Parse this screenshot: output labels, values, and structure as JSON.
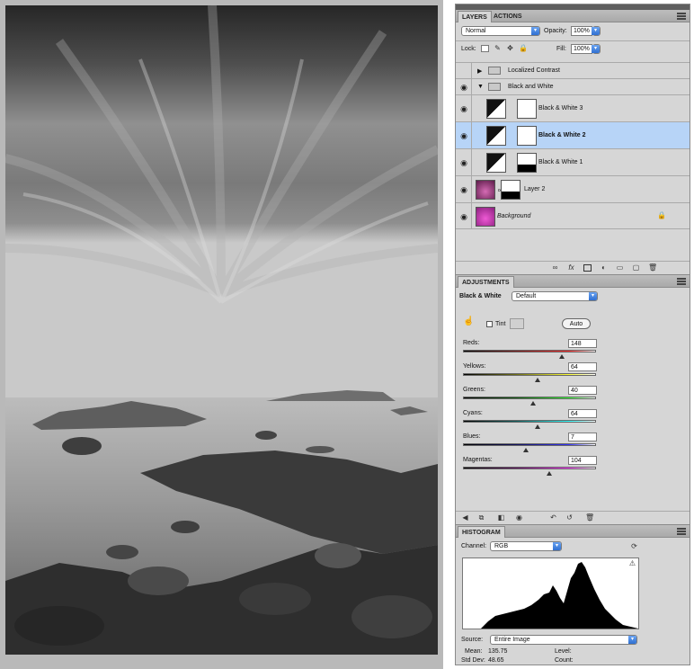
{
  "layers_panel": {
    "tabs": [
      "LAYERS",
      "ACTIONS"
    ],
    "blend_mode": "Normal",
    "opacity_label": "Opacity:",
    "opacity_value": "100%",
    "lock_label": "Lock:",
    "fill_label": "Fill:",
    "fill_value": "100%",
    "layers": [
      {
        "name": "Localized Contrast",
        "type": "group-collapsed",
        "visible": false
      },
      {
        "name": "Black and White",
        "type": "group-expanded",
        "visible": true
      },
      {
        "name": "Black & White 3",
        "type": "adjustment",
        "visible": true
      },
      {
        "name": "Black & White 2",
        "type": "adjustment",
        "visible": true,
        "selected": true
      },
      {
        "name": "Black & White 1",
        "type": "adjustment",
        "visible": true
      },
      {
        "name": "Layer 2",
        "type": "pixel",
        "visible": true
      },
      {
        "name": "Background",
        "type": "background",
        "visible": true,
        "locked": true
      }
    ]
  },
  "adjustments_panel": {
    "tab": "ADJUSTMENTS",
    "title": "Black & White",
    "preset": "Default",
    "tint_label": "Tint",
    "auto_label": "Auto",
    "sliders": [
      {
        "label": "Reds:",
        "value": "148",
        "fraction": 0.74,
        "gradient": "#7a1a1a,#ff2a2a"
      },
      {
        "label": "Yellows:",
        "value": "64",
        "fraction": 0.56,
        "gradient": "#6e6e14,#ffff33"
      },
      {
        "label": "Greens:",
        "value": "40",
        "fraction": 0.53,
        "gradient": "#145a14,#33ff33"
      },
      {
        "label": "Cyans:",
        "value": "64",
        "fraction": 0.56,
        "gradient": "#125e5e,#33ffff"
      },
      {
        "label": "Blues:",
        "value": "7",
        "fraction": 0.47,
        "gradient": "#12125e,#3333ff"
      },
      {
        "label": "Magentas:",
        "value": "104",
        "fraction": 0.65,
        "gradient": "#5e125e,#ff33ff"
      }
    ]
  },
  "histogram_panel": {
    "tab": "HISTOGRAM",
    "channel_label": "Channel:",
    "channel_value": "RGB",
    "source_label": "Source:",
    "source_value": "Entire Image",
    "mean_label": "Mean:",
    "mean_value": "135.75",
    "level_label": "Level:",
    "stddev_label": "Std Dev:",
    "stddev_value": "48.65",
    "count_label": "Count:"
  },
  "colors": {
    "panel_bg": "#d6d6d6",
    "selection": "#b7d4f7",
    "accent_blue": "#2f6fd1"
  }
}
